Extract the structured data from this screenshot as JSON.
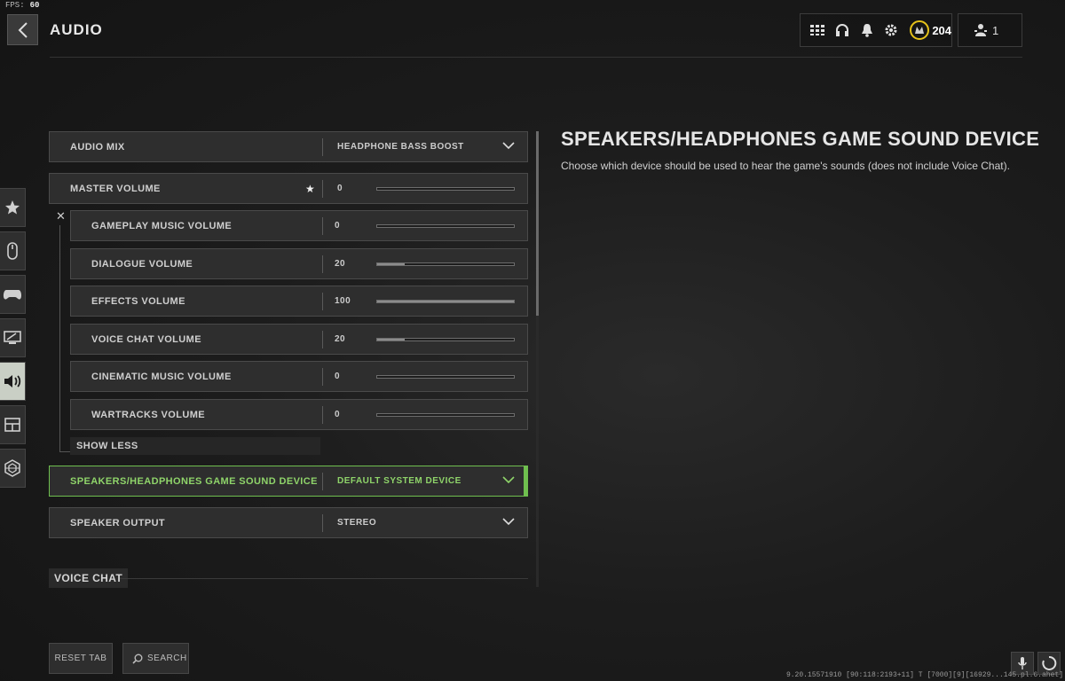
{
  "hud": {
    "fps_label": "FPS:",
    "fps_value": "60"
  },
  "header": {
    "title": "AUDIO",
    "cod_points": "204",
    "party_count": "1"
  },
  "settings": {
    "audio_mix": {
      "label": "AUDIO MIX",
      "value": "HEADPHONE BASS BOOST"
    },
    "master_volume": {
      "label": "MASTER VOLUME",
      "value": "0",
      "level": 0
    },
    "sub_volumes": [
      {
        "label": "GAMEPLAY MUSIC VOLUME",
        "value": "0",
        "level": 0
      },
      {
        "label": "DIALOGUE VOLUME",
        "value": "20",
        "level": 0.2
      },
      {
        "label": "EFFECTS VOLUME",
        "value": "100",
        "level": 1.0
      },
      {
        "label": "VOICE CHAT VOLUME",
        "value": "20",
        "level": 0.2
      },
      {
        "label": "CINEMATIC MUSIC VOLUME",
        "value": "0",
        "level": 0
      },
      {
        "label": "WARTRACKS VOLUME",
        "value": "0",
        "level": 0
      }
    ],
    "show_less": "SHOW LESS",
    "sound_device": {
      "label": "SPEAKERS/HEADPHONES GAME SOUND DEVICE",
      "value": "DEFAULT SYSTEM DEVICE"
    },
    "speaker_output": {
      "label": "SPEAKER OUTPUT",
      "value": "STEREO"
    },
    "section_voice_chat": "VOICE CHAT"
  },
  "description": {
    "title": "SPEAKERS/HEADPHONES GAME SOUND DEVICE",
    "text": "Choose which device should be used to hear the game's sounds (does not include Voice Chat)."
  },
  "footer": {
    "reset_label": "RESET TAB",
    "search_label": "SEARCH",
    "version": "9.20.15571910 [90:118:2193+11] T [7000][9][16929...145.pl.6.ahet]"
  },
  "colors": {
    "accent_green": "#6fbf4f",
    "active_tab": "#c9cfc5"
  }
}
